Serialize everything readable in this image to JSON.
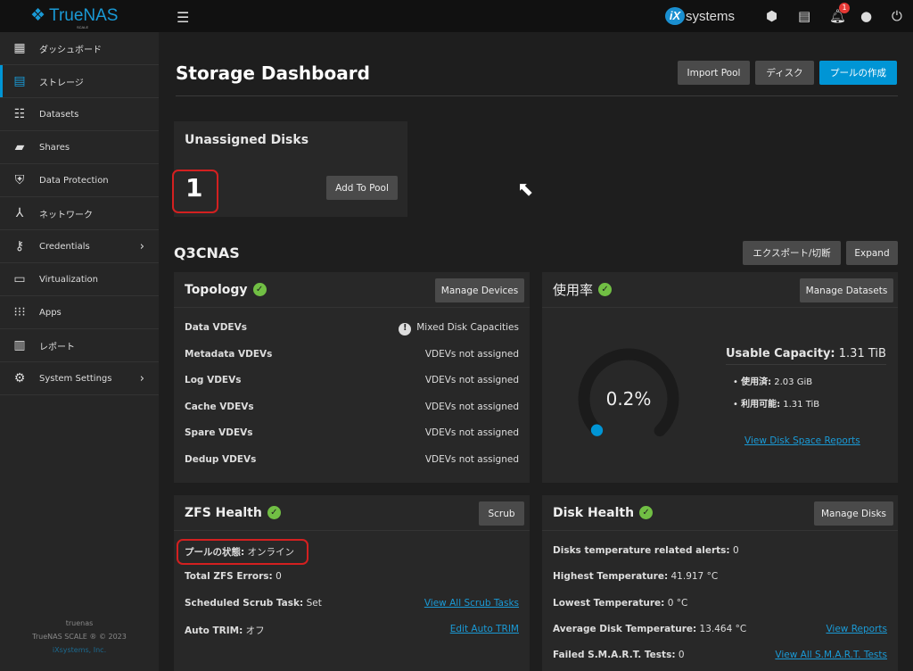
{
  "topbar": {
    "brand": "TrueNAS",
    "brand_sub": "SCALE",
    "vendor": "systems",
    "vendor_mark": "iX",
    "notification_count": "1"
  },
  "sidebar": {
    "items": [
      {
        "label": "ダッシュボード",
        "icon": "dashboard-icon"
      },
      {
        "label": "ストレージ",
        "icon": "storage-icon",
        "active": true
      },
      {
        "label": "Datasets",
        "icon": "datasets-icon"
      },
      {
        "label": "Shares",
        "icon": "shares-icon"
      },
      {
        "label": "Data Protection",
        "icon": "shield-icon"
      },
      {
        "label": "ネットワーク",
        "icon": "network-icon"
      },
      {
        "label": "Credentials",
        "icon": "key-icon",
        "submenu": true
      },
      {
        "label": "Virtualization",
        "icon": "laptop-icon"
      },
      {
        "label": "Apps",
        "icon": "apps-icon"
      },
      {
        "label": "レポート",
        "icon": "reports-icon"
      },
      {
        "label": "System Settings",
        "icon": "gear-icon",
        "submenu": true
      }
    ],
    "hostname": "truenas",
    "copyright": "TrueNAS SCALE ® © 2023",
    "company": "iXsystems, Inc."
  },
  "page": {
    "title": "Storage Dashboard",
    "import_pool": "Import Pool",
    "disks": "ディスク",
    "create_pool": "プールの作成"
  },
  "unassigned": {
    "title": "Unassigned Disks",
    "count": "1",
    "add": "Add To Pool"
  },
  "pool": {
    "name": "Q3CNAS",
    "export": "エクスポート/切断",
    "expand": "Expand"
  },
  "topology": {
    "title": "Topology",
    "manage": "Manage Devices",
    "rows": [
      {
        "k": "Data VDEVs",
        "v": "Mixed Disk Capacities",
        "warn": true
      },
      {
        "k": "Metadata VDEVs",
        "v": "VDEVs not assigned"
      },
      {
        "k": "Log VDEVs",
        "v": "VDEVs not assigned"
      },
      {
        "k": "Cache VDEVs",
        "v": "VDEVs not assigned"
      },
      {
        "k": "Spare VDEVs",
        "v": "VDEVs not assigned"
      },
      {
        "k": "Dedup VDEVs",
        "v": "VDEVs not assigned"
      }
    ]
  },
  "usage": {
    "title": "使用率",
    "manage": "Manage Datasets",
    "percent": 0.2,
    "percent_label": "0.2%",
    "capacity_label": "Usable Capacity:",
    "capacity": "1.31 TiB",
    "used_label": "使用済:",
    "used": "2.03 GiB",
    "avail_label": "利用可能:",
    "avail": "1.31 TiB",
    "link": "View Disk Space Reports",
    "accent": "#0095d5"
  },
  "zfs": {
    "title": "ZFS Health",
    "scrub": "Scrub",
    "rows": [
      {
        "k": "プールの状態:",
        "v": "オンライン"
      },
      {
        "k": "Total ZFS Errors:",
        "v": "0"
      },
      {
        "k": "Scheduled Scrub Task:",
        "v": "Set",
        "link": "View All Scrub Tasks"
      },
      {
        "k": "Auto TRIM:",
        "v": "オフ",
        "link": "Edit Auto TRIM"
      }
    ]
  },
  "disk": {
    "title": "Disk Health",
    "manage": "Manage Disks",
    "rows": [
      {
        "k": "Disks temperature related alerts:",
        "v": "0"
      },
      {
        "k": "Highest Temperature:",
        "v": "41.917 °C"
      },
      {
        "k": "Lowest Temperature:",
        "v": "0 °C"
      },
      {
        "k": "Average Disk Temperature:",
        "v": "13.464 °C",
        "link": "View Reports"
      },
      {
        "k": "Failed S.M.A.R.T. Tests:",
        "v": "0",
        "link": "View All S.M.A.R.T. Tests"
      }
    ]
  }
}
